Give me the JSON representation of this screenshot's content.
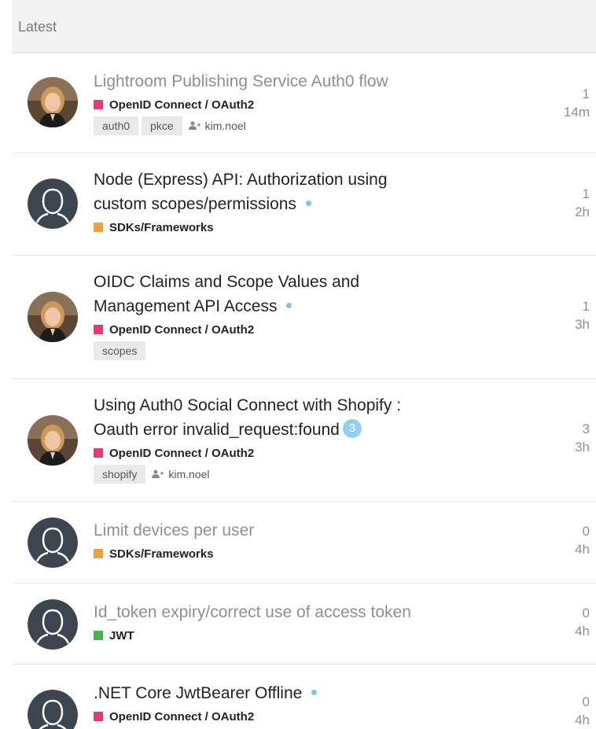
{
  "header": {
    "title": "Latest"
  },
  "colors": {
    "openid": "#e03c7a",
    "sdks": "#f0a043",
    "jwt": "#4caf50"
  },
  "topics": [
    {
      "title": "Lightroom Publishing Service Auth0 flow",
      "visited": true,
      "category": "OpenID Connect / OAuth2",
      "category_color": "#e03c7a",
      "tags": [
        "auth0",
        "pkce"
      ],
      "assigned": "kim.noel",
      "replies": "1",
      "age": "14m",
      "avatar": "photo"
    },
    {
      "title": "Node (Express) API: Authorization using custom scopes/permissions",
      "visited": false,
      "unread_dot": true,
      "category": "SDKs/Frameworks",
      "category_color": "#f0a043",
      "tags": [],
      "replies": "1",
      "age": "2h",
      "avatar": "default"
    },
    {
      "title": "OIDC Claims and Scope Values and Management API Access",
      "visited": false,
      "unread_dot": true,
      "category": "OpenID Connect / OAuth2",
      "category_color": "#e03c7a",
      "tags": [
        "scopes"
      ],
      "replies": "1",
      "age": "3h",
      "avatar": "photo"
    },
    {
      "title": "Using Auth0 Social Connect with Shopify : Oauth error invalid_request:found",
      "visited": false,
      "new_count": "3",
      "category": "OpenID Connect / OAuth2",
      "category_color": "#e03c7a",
      "tags": [
        "shopify"
      ],
      "assigned": "kim.noel",
      "replies": "3",
      "age": "3h",
      "avatar": "photo"
    },
    {
      "title": "Limit devices per user",
      "visited": true,
      "category": "SDKs/Frameworks",
      "category_color": "#f0a043",
      "tags": [],
      "replies": "0",
      "age": "4h",
      "avatar": "default"
    },
    {
      "title": "Id_token expiry/correct use of access token",
      "visited": true,
      "category": "JWT",
      "category_color": "#4caf50",
      "tags": [],
      "replies": "0",
      "age": "4h",
      "avatar": "default"
    },
    {
      "title": ".NET Core JwtBearer Offline",
      "visited": false,
      "unread_dot": true,
      "category": "OpenID Connect / OAuth2",
      "category_color": "#e03c7a",
      "tags": [],
      "replies": "0",
      "age": "4h",
      "avatar": "default"
    }
  ]
}
